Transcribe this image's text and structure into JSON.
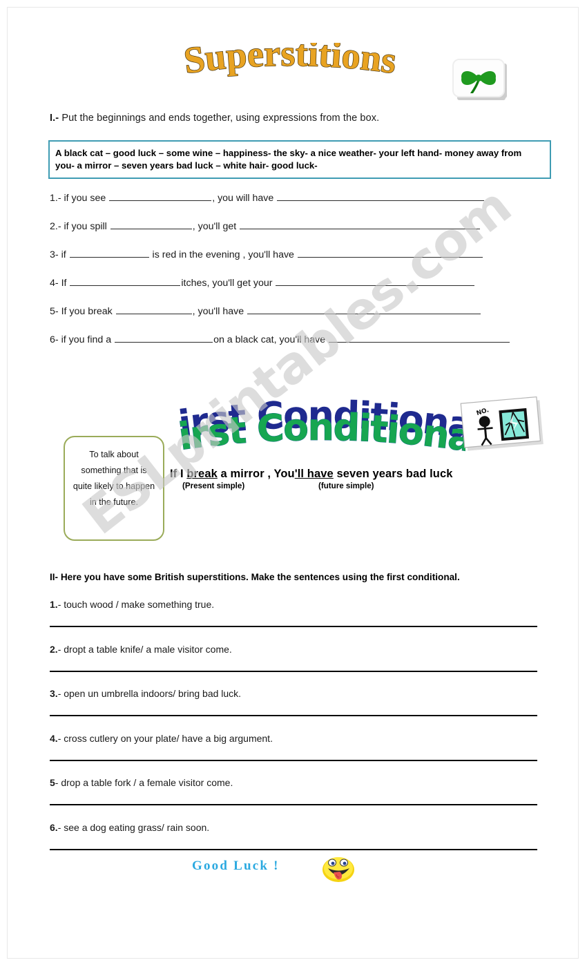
{
  "document": {
    "title": "Superstitions",
    "footer_text": "Good  Luck  !",
    "watermark": "ESLprintables.com"
  },
  "colors": {
    "title_fill": "#e8a322",
    "title_outline": "#5a4012",
    "wordbank_border": "#3f9cb3",
    "notebox_border": "#9aab59",
    "wordart_green": "#17a651",
    "wordart_blue": "#1f2a8f",
    "footer_blue": "#2ba9e0",
    "clover_green": "#1f9a1f",
    "answer_rule": "#000000"
  },
  "icons": {
    "clover": "four-leaf-clover-icon",
    "mirror": "broken-mirror-clipart-icon",
    "smiley": "tongue-out-smiley-icon"
  },
  "section_one": {
    "instruction_number": "I.-",
    "instruction_text": " Put the beginnings and ends together, using expressions from the box.",
    "wordbank": "A black cat – good luck – some wine – happiness- the sky- a nice weather- your left hand- money away from you- a mirror – seven years bad luck – white hair- good luck-",
    "items": [
      {
        "number": "1.-",
        "before": " if you see ",
        "blank1_width": 148,
        "middle": ", you will have ",
        "blank2_width": 300
      },
      {
        "number": "2.-",
        "before": " if you spill ",
        "blank1_width": 118,
        "middle": ", you'll get ",
        "blank2_width": 348
      },
      {
        "number": "3-",
        "before": " if ",
        "blank1_width": 115,
        "middle": " is red in the evening , you'll have ",
        "blank2_width": 268
      },
      {
        "number": "4-",
        "before": " If ",
        "blank1_width": 160,
        "middle": "itches, you'll get your ",
        "blank2_width": 288
      },
      {
        "number": "5-",
        "before": " If you break ",
        "blank1_width": 110,
        "middle": ", you'll have ",
        "blank2_width": 338
      },
      {
        "number": "6-",
        "before": " if you find a ",
        "blank1_width": 142,
        "middle": "on a black cat, you'll have ",
        "blank2_width": 262
      }
    ]
  },
  "grammar_box": {
    "note": "To talk about something that is quite likely to happen in the future.",
    "heading": "First Conditional",
    "example_part1": "If I ",
    "example_verb1": "break",
    "example_part2": " a mirror , You",
    "example_verb2": "'ll have",
    "example_part3": " seven years bad luck",
    "tag_present": "(Present simple)",
    "tag_future": "(future simple)",
    "clipart_caption": "NO."
  },
  "section_two": {
    "instruction": "II- Here you have some British superstitions. Make the sentences using the first conditional.",
    "items": [
      {
        "number": "1.",
        "text": "- touch wood / make something true."
      },
      {
        "number": "2.",
        "text": "- dropt a table knife/ a male visitor come."
      },
      {
        "number": "3.",
        "text": "- open un umbrella indoors/ bring bad luck."
      },
      {
        "number": "4.",
        "text": "- cross cutlery on your plate/ have a big argument."
      },
      {
        "number": "5",
        "text": "- drop a table fork / a female visitor come."
      },
      {
        "number": "6.",
        "text": "- see a dog eating grass/ rain soon."
      }
    ]
  }
}
